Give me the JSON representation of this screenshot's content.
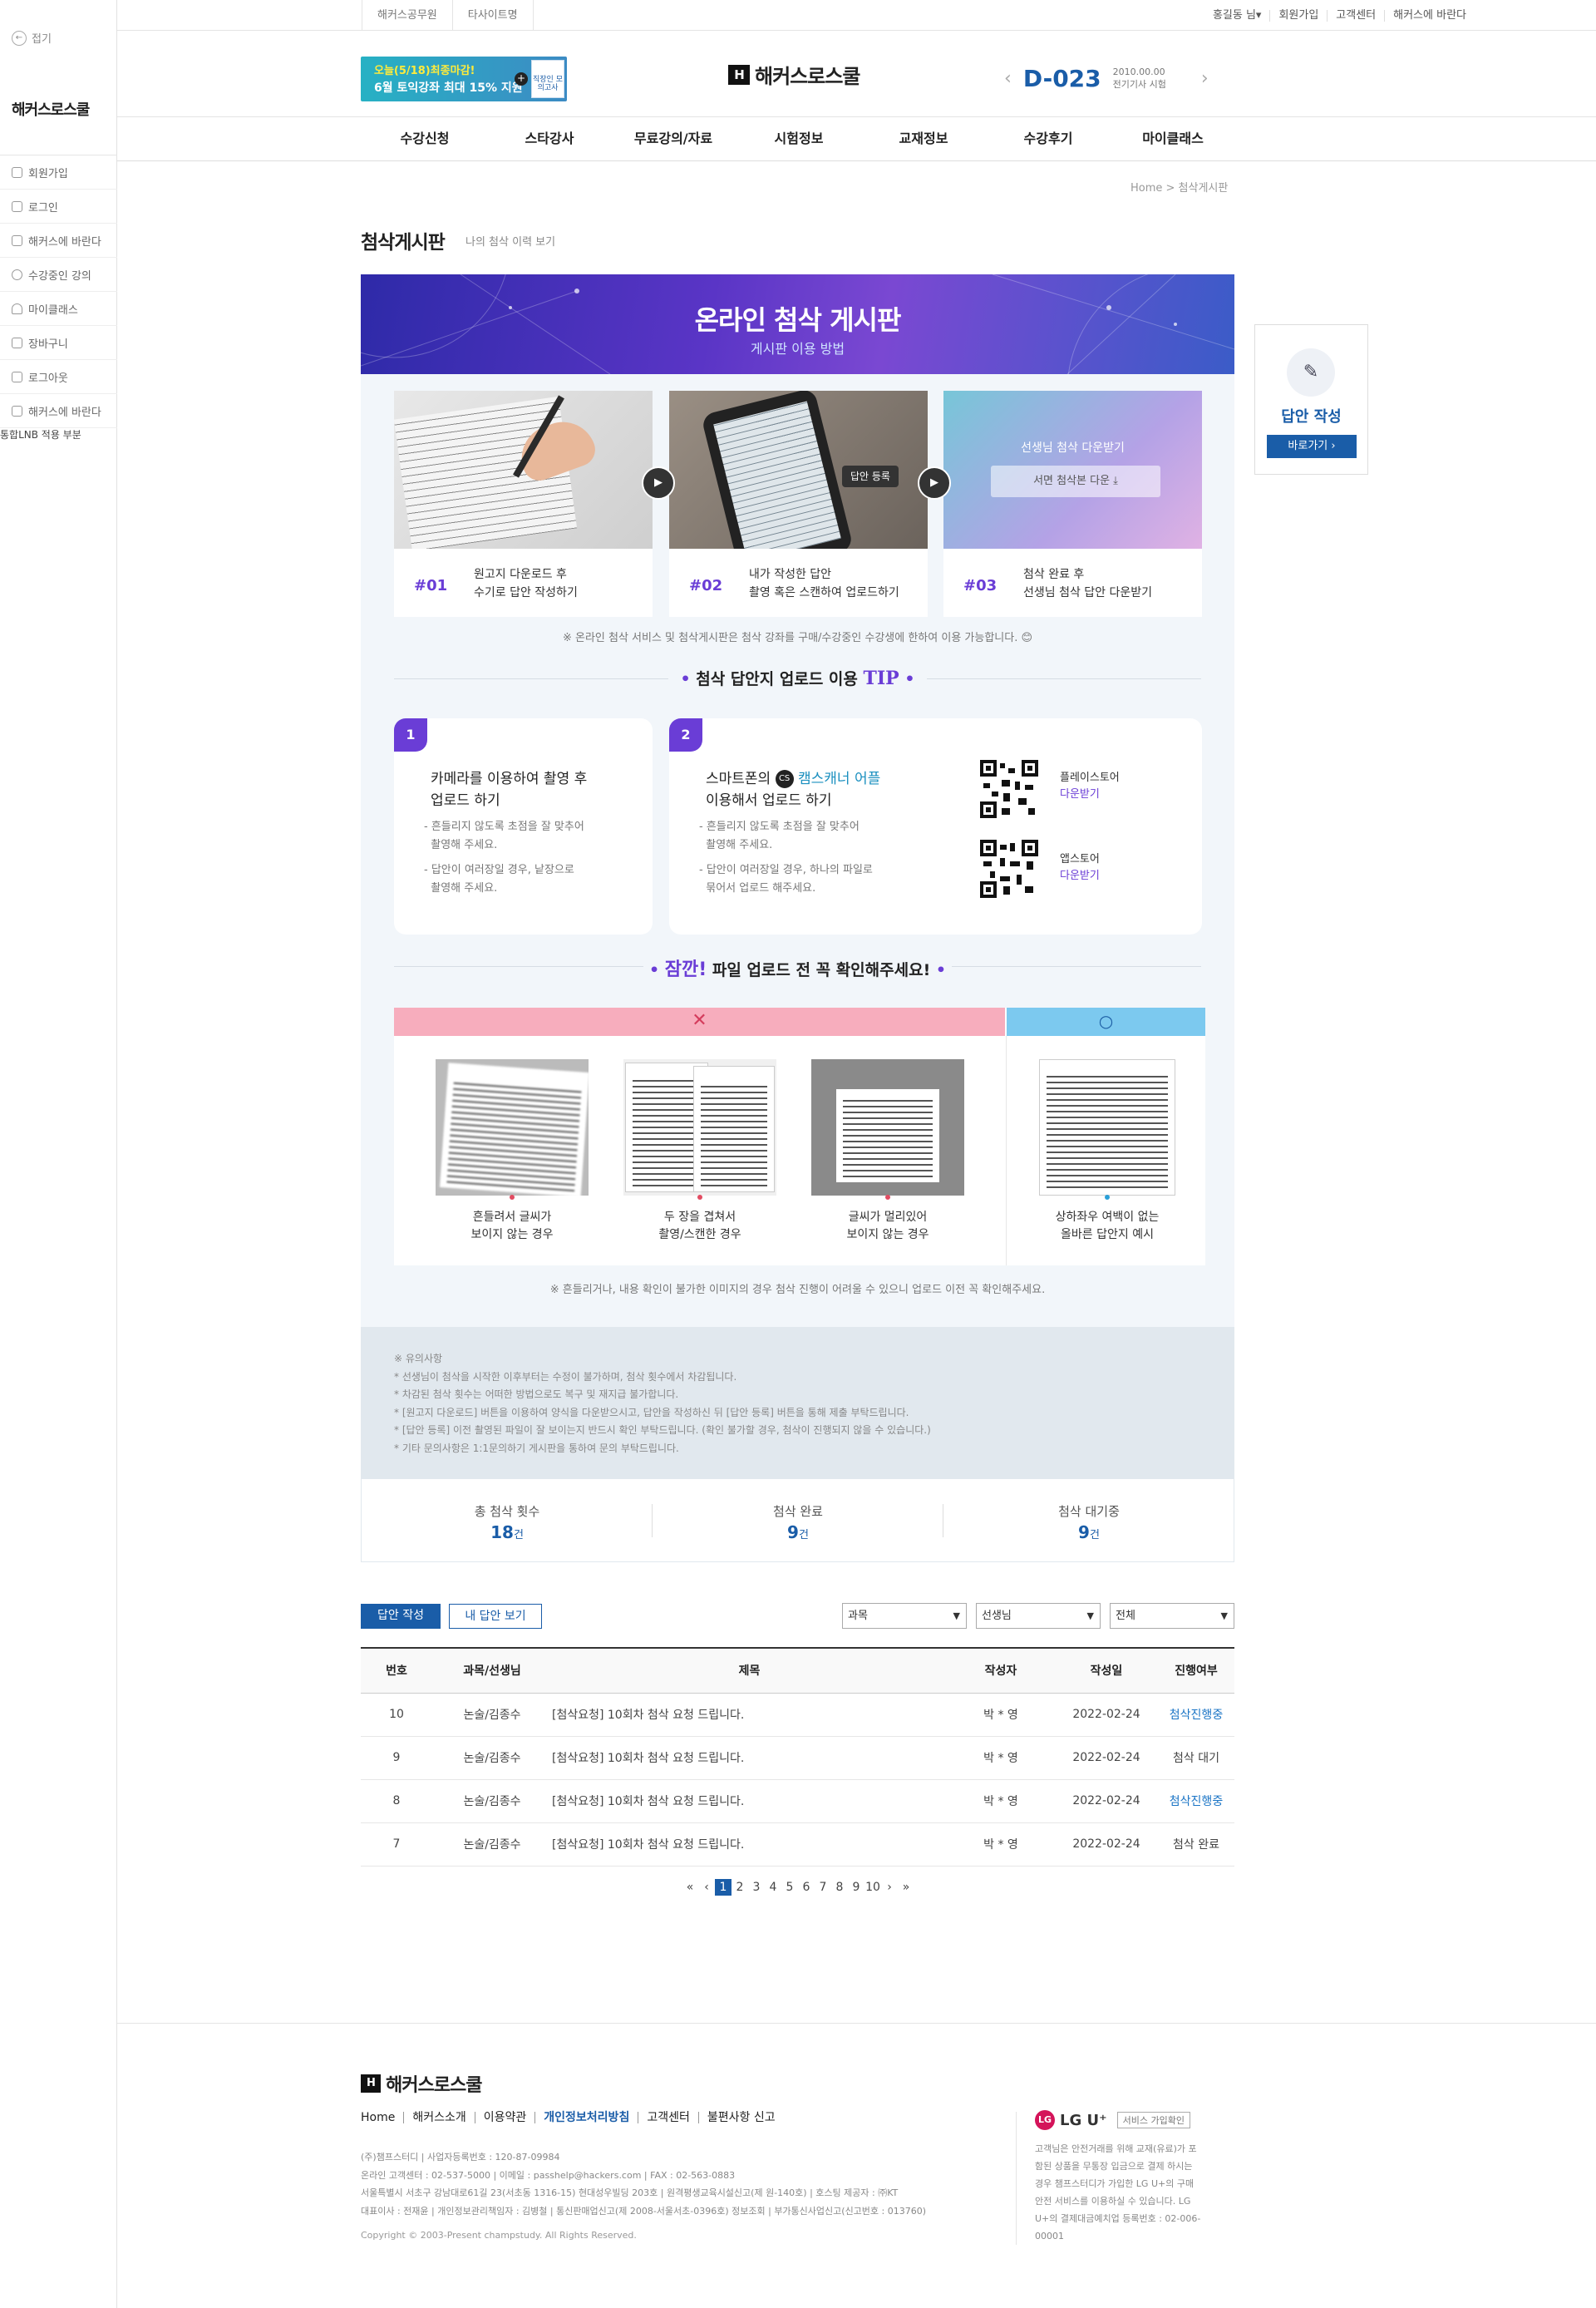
{
  "lnb": {
    "fold": "접기",
    "logo": "해커스로스쿨",
    "items": [
      "회원가입",
      "로그인",
      "해커스에 바란다",
      "수강중인 강의",
      "마이클래스",
      "장바구니",
      "로그아웃",
      "해커스에 바란다"
    ],
    "note": "통합LNB 적용 부분"
  },
  "util": {
    "left": [
      "해커스공무원",
      "타사이트명"
    ],
    "right": [
      "홍길동 님▾",
      "회원가입",
      "고객센터",
      "해커스에 바란다"
    ]
  },
  "banner": {
    "line1": "오늘(5/18)최종마감!",
    "line2": "6월 토익강좌 최대 15% 지원",
    "book": "직장인 모의고사"
  },
  "logo": "해커스로스쿨",
  "dday": {
    "num": "D-023",
    "date": "2010.00.00",
    "exam": "전기기사 시험"
  },
  "gnb": [
    "수강신청",
    "스타강사",
    "무료강의/자료",
    "시험정보",
    "교재정보",
    "수강후기",
    "마이클래스"
  ],
  "breadcrumb": "Home  >  첨삭게시판",
  "page": {
    "title": "첨삭게시판",
    "sub": "나의 첨삭 이력 보기"
  },
  "hero": {
    "title": "온라인 첨삭 게시판",
    "sub": "게시판 이용 방법"
  },
  "steps": [
    {
      "no": "#01",
      "line1": "원고지 다운로드 후",
      "line2": "수기로 답안 작성하기"
    },
    {
      "no": "#02",
      "line1": "내가 작성한 답안",
      "line2": "촬영 혹은 스캔하여 업로드하기",
      "overlay": "답안 등록"
    },
    {
      "no": "#03",
      "line1": "첨삭 완료 후",
      "line2": "선생님 첨삭 답안 다운받기",
      "overlay": "선생님 첨삭 다운받기",
      "button": "서면 첨삭본 다운 ⤓"
    }
  ],
  "notice1": "※ 온라인 첨삭 서비스 및 첨삭게시판은 첨삭 강좌를 구매/수강중인 수강생에 한하여 이용 가능합니다. 😊",
  "tip": {
    "title_pre": "첨삭 답안지 업로드 이용 ",
    "title_em": "TIP",
    "cards": [
      {
        "num": "1",
        "line1": "카메라를 이용하여 촬영 후",
        "line2": "업로드 하기",
        "items": [
          "- 흔들리지 않도록 초점을 잘 맞추어\n  촬영해 주세요.",
          "- 답안이 여러장일 경우, 낱장으로\n  촬영해 주세요."
        ]
      },
      {
        "num": "2",
        "line1a": "스마트폰의 ",
        "cs": "CS",
        "app": "캠스캐너 어플",
        "line2": "이용해서 업로드 하기",
        "items": [
          "- 흔들리지 않도록 초점을 잘 맞추어\n  촬영해 주세요.",
          "- 답안이 여러장일 경우, 하나의 파일로\n  묶어서 업로드 해주세요."
        ]
      }
    ],
    "stores": [
      {
        "name": "플레이스토어",
        "link": "다운받기"
      },
      {
        "name": "앱스토어",
        "link": "다운받기"
      }
    ]
  },
  "check": {
    "title_em": "잠깐!",
    "title_rest": " 파일 업로드 전 꼭 확인해주세요!",
    "bad": "✕",
    "good": "○",
    "items": [
      {
        "l1": "흔들려서 글씨가",
        "l2": "보이지 않는 경우"
      },
      {
        "l1": "두 장을 겹쳐서",
        "l2": "촬영/스캔한 경우"
      },
      {
        "l1": "글씨가 멀리있어",
        "l2": "보이지 않는 경우"
      },
      {
        "l1": "상하좌우 여백이 없는",
        "l2": "올바른 답안지 예시"
      }
    ]
  },
  "notice2": "※ 흔들리거나, 내용 확인이 불가한 이미지의 경우 첨삭 진행이 어려울 수 있으니 업로드 이전 꼭 확인해주세요.",
  "caution": [
    "※ 유의사항",
    "* 선생님이 첨삭을 시작한 이후부터는 수정이 불가하며, 첨삭 횟수에서 차감됩니다.",
    "* 차감된 첨삭 횟수는 어떠한 방법으로도 복구 및 재지급 불가합니다.",
    "* [원고지 다운로드] 버튼을 이용하여 양식을 다운받으시고, 답안을 작성하신 뒤 [답안 등록] 버튼을 통해 제출 부탁드립니다.",
    "* [답안 등록] 이전 촬영된 파일이 잘 보이는지 반드시 확인 부탁드립니다. (확인 불가할 경우, 첨삭이 진행되지 않을 수 있습니다.)",
    "* 기타 문의사항은 1:1문의하기 게시판을 통하여 문의 부탁드립니다."
  ],
  "stats": [
    {
      "label": "총 첨삭 횟수",
      "value": "18",
      "unit": "건"
    },
    {
      "label": "첨삭 완료",
      "value": "9",
      "unit": "건"
    },
    {
      "label": "첨삭 대기중",
      "value": "9",
      "unit": "건"
    }
  ],
  "float": {
    "title": "답안 작성",
    "btn": "바로가기 ›"
  },
  "board": {
    "write": "답안 작성",
    "mine": "내 답안 보기",
    "filters": [
      "과목",
      "선생님",
      "전체"
    ],
    "headers": [
      "번호",
      "과목/선생님",
      "제목",
      "작성자",
      "작성일",
      "진행여부"
    ],
    "rows": [
      {
        "no": "10",
        "subj": "논술/김종수",
        "title": "[첨삭요청] 10회차 첨삭 요청 드립니다.",
        "author": "박 * 영",
        "date": "2022-02-24",
        "status": "첨삭진행중",
        "blue": true
      },
      {
        "no": "9",
        "subj": "논술/김종수",
        "title": "[첨삭요청] 10회차 첨삭 요청 드립니다.",
        "author": "박 * 영",
        "date": "2022-02-24",
        "status": "첨삭 대기",
        "blue": false
      },
      {
        "no": "8",
        "subj": "논술/김종수",
        "title": "[첨삭요청] 10회차 첨삭 요청 드립니다.",
        "author": "박 * 영",
        "date": "2022-02-24",
        "status": "첨삭진행중",
        "blue": true
      },
      {
        "no": "7",
        "subj": "논술/김종수",
        "title": "[첨삭요청] 10회차 첨삭 요청 드립니다.",
        "author": "박 * 영",
        "date": "2022-02-24",
        "status": "첨삭 완료",
        "blue": false
      }
    ],
    "pages": [
      "1",
      "2",
      "3",
      "4",
      "5",
      "6",
      "7",
      "8",
      "9",
      "10"
    ],
    "current": "1"
  },
  "footer": {
    "logo": "해커스로스쿨",
    "nav": [
      "Home",
      "해커스소개",
      "이용약관",
      "개인정보처리방침",
      "고객센터",
      "불편사항 신고"
    ],
    "info": [
      "(주)챔프스터디 | 사업자등록번호 : 120-87-09984",
      "온라인 고객센터 : 02-537-5000 | 이메일 : passhelp@hackers.com | FAX : 02-563-0883",
      "서울특별시 서초구 강남대로61길 23(서초동 1316-15) 현대성우빌딩 203호 | 원격평생교육시설신고(제 원-140호) | 호스팅 제공자 : ㈜KT",
      "대표이사 : 전재윤 | 개인정보관리책임자 : 김병철 | 통신판매업신고(제 2008-서울서초-0396호) 정보조회 | 부가통신사업신고(신고번호 : 013760)"
    ],
    "copy": "Copyright © 2003-Present champstudy. All Rights Reserved.",
    "lgu": {
      "name": "LG U⁺",
      "box": "서비스 가입확인",
      "text": "고객님은 안전거래를 위해 교재(유료)가 포함된 상품을 무통장 입금으로 결제 하시는 경우 챔프스터디가 가입한 LG U+의 구매 안전 서비스를 이용하실 수 있습니다. LG U+의 결제대금예치업 등록번호 : 02-006-00001"
    }
  }
}
